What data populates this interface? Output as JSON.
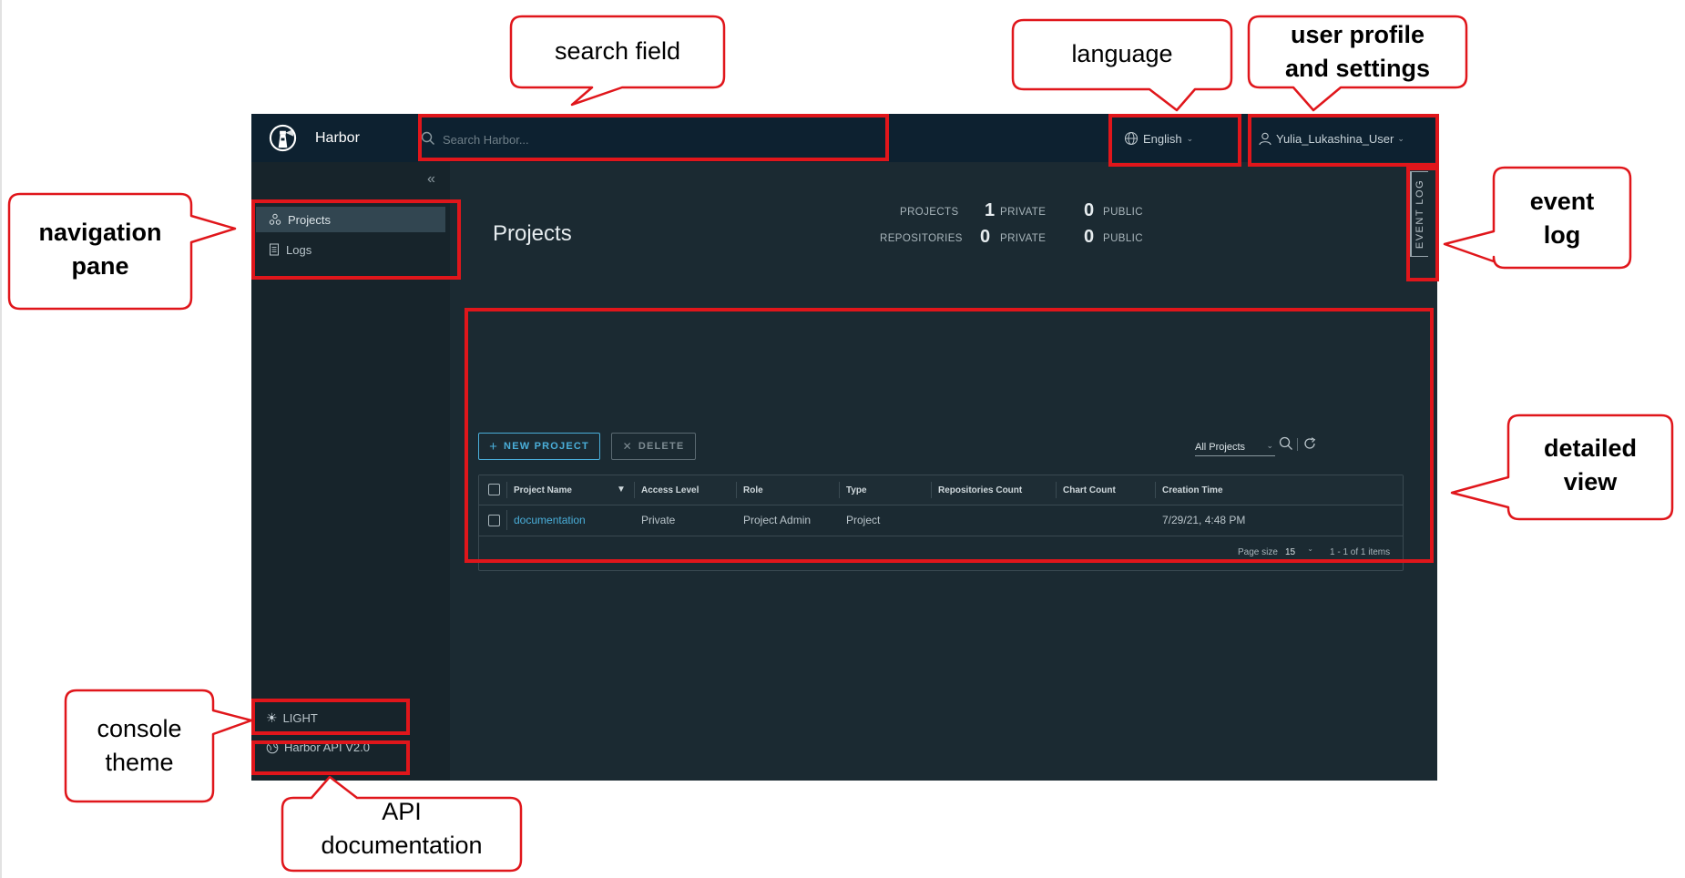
{
  "header": {
    "brand": "Harbor",
    "search_placeholder": "Search Harbor...",
    "language": "English",
    "user": "Yulia_Lukashina_User"
  },
  "sidebar": {
    "items": [
      {
        "label": "Projects",
        "icon": "projects-icon",
        "active": true
      },
      {
        "label": "Logs",
        "icon": "logs-icon",
        "active": false
      }
    ],
    "theme_label": "LIGHT",
    "api_label": "Harbor API V2.0"
  },
  "event_log": "EVENT LOG",
  "main": {
    "title": "Projects",
    "summary": {
      "projects_label": "PROJECTS",
      "repositories_label": "REPOSITORIES",
      "private_label": "PRIVATE",
      "public_label": "PUBLIC",
      "projects_private": "1",
      "projects_public": "0",
      "repositories_private": "0",
      "repositories_public": "0"
    },
    "toolbar": {
      "new_project": "NEW PROJECT",
      "delete": "DELETE",
      "filter_selected": "All Projects"
    },
    "table": {
      "columns": [
        "Project Name",
        "Access Level",
        "Role",
        "Type",
        "Repositories Count",
        "Chart Count",
        "Creation Time"
      ],
      "rows": [
        {
          "name": "documentation",
          "access": "Private",
          "role": "Project Admin",
          "type": "Project",
          "repos": "",
          "charts": "",
          "created": "7/29/21, 4:48 PM"
        }
      ],
      "page_size_label": "Page size",
      "page_size": "15",
      "pagination": "1 - 1 of 1 items"
    }
  },
  "callouts": {
    "search_field": "search field",
    "language": "language",
    "user_profile_line1": "user profile",
    "user_profile_line2": "and settings",
    "navigation_line1": "navigation",
    "navigation_line2": "pane",
    "event_log_line1": "event",
    "event_log_line2": "log",
    "detailed_line1": "detailed",
    "detailed_line2": "view",
    "console_line1": "console",
    "console_line2": "theme",
    "api_line1": "API",
    "api_line2": "documentation"
  },
  "colors": {
    "header_bg": "#0d2130",
    "sidebar_bg": "#17242b",
    "content_bg": "#1b2a32",
    "accent": "#4aaed9",
    "annotation_red": "#e0161b"
  }
}
